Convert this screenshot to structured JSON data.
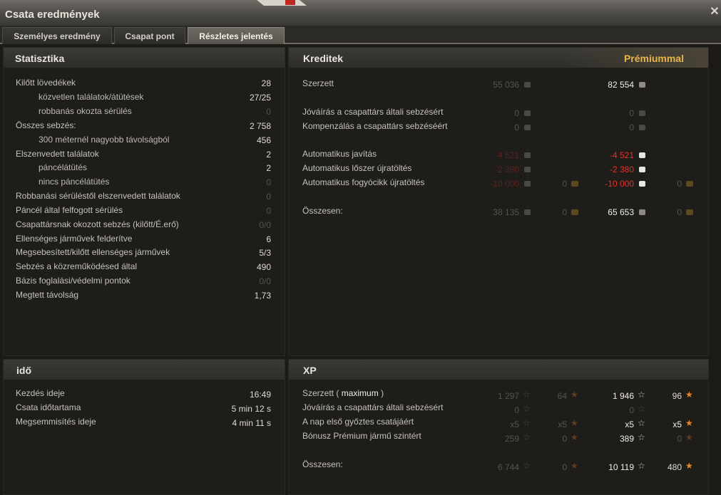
{
  "window": {
    "title": "Csata eredmények"
  },
  "tabs": [
    {
      "label": "Személyes eredmény"
    },
    {
      "label": "Csapat pont"
    },
    {
      "label": "Részletes jelentés"
    }
  ],
  "stats": {
    "title": "Statisztika",
    "rows": [
      {
        "label": "Kilőtt lövedékek",
        "value": "28"
      },
      {
        "label": "közvetlen találatok/átütések",
        "value": "27/25"
      },
      {
        "label": "robbanás okozta sérülés",
        "value": "0"
      },
      {
        "label": "Összes sebzés:",
        "value": "2 758"
      },
      {
        "label": "300 méternél nagyobb távolságból",
        "value": "456"
      },
      {
        "label": "Elszenvedett találatok",
        "value": "2"
      },
      {
        "label": "páncélátütés",
        "value": "2"
      },
      {
        "label": "nincs páncélátütés",
        "value": "0"
      },
      {
        "label": "Robbanási sérüléstől elszenvedett találatok",
        "value": "0"
      },
      {
        "label": "Páncél által felfogott sérülés",
        "value": "0"
      },
      {
        "label": "Csapattársnak okozott sebzés (kilőtt/É.erő)",
        "value": "0/0"
      },
      {
        "label": "Ellenséges járművek felderítve",
        "value": "6"
      },
      {
        "label": "Megsebesített/kilőtt ellenséges járművek",
        "value": "5/3"
      },
      {
        "label": "Sebzés a közreműködésed által",
        "value": "490"
      },
      {
        "label": "Bázis foglalási/védelmi pontok",
        "value": "0/0"
      },
      {
        "label": "Megtett távolság",
        "value": "1,73"
      }
    ]
  },
  "credits": {
    "title": "Kreditek",
    "premium_label": "Prémiummal",
    "rows": [
      {
        "label": "Szerzett",
        "base": "55 036",
        "prem": "82 554"
      },
      {
        "label": "Jóváírás a csapattárs általi sebzésért",
        "base": "0",
        "prem": "0"
      },
      {
        "label": "Kompenzálás a csapattárs sebzéséért",
        "base": "0",
        "prem": "0"
      },
      {
        "label": "Automatikus javítás",
        "base": "-4 521",
        "prem": "-4 521"
      },
      {
        "label": "Automatikus lőszer újratöltés",
        "base": "-2 380",
        "prem": "-2 380"
      },
      {
        "label": "Automatikus fogyócikk újratöltés",
        "base": "-10 000",
        "base_gold": "0",
        "prem": "-10 000",
        "prem_gold": "0"
      },
      {
        "label": "Összesen:",
        "base": "38 135",
        "base_gold": "0",
        "prem": "65 653",
        "prem_gold": "0"
      }
    ]
  },
  "time": {
    "title": "idő",
    "rows": [
      {
        "label": "Kezdés ideje",
        "value": "16:49"
      },
      {
        "label": "Csata időtartama",
        "value": "5 min 12 s"
      },
      {
        "label": "Megsemmisítés ideje",
        "value": "4 min 11 s"
      }
    ]
  },
  "xp": {
    "title": "XP",
    "earned_label": "Szerzett (",
    "earned_max": "maximum",
    "earned_close": ")",
    "rows": [
      {
        "label": "Szerzett ( maximum )",
        "base_xp": "1 297",
        "base_free": "64",
        "prem_xp": "1 946",
        "prem_free": "96"
      },
      {
        "label": "Jóváírás a csapattárs általi sebzésért",
        "base_xp": "0",
        "prem_xp": "0"
      },
      {
        "label": "A nap első győztes csatájáért",
        "base_xp": "x5",
        "base_free": "x5",
        "prem_xp": "x5",
        "prem_free": "x5"
      },
      {
        "label": "Bónusz Prémium jármű szintért",
        "base_xp": "259",
        "base_free": "0",
        "prem_xp": "389",
        "prem_free": "0"
      },
      {
        "label": "Összesen:",
        "base_xp": "6 744",
        "base_free": "0",
        "prem_xp": "10 119",
        "prem_free": "480"
      }
    ]
  }
}
